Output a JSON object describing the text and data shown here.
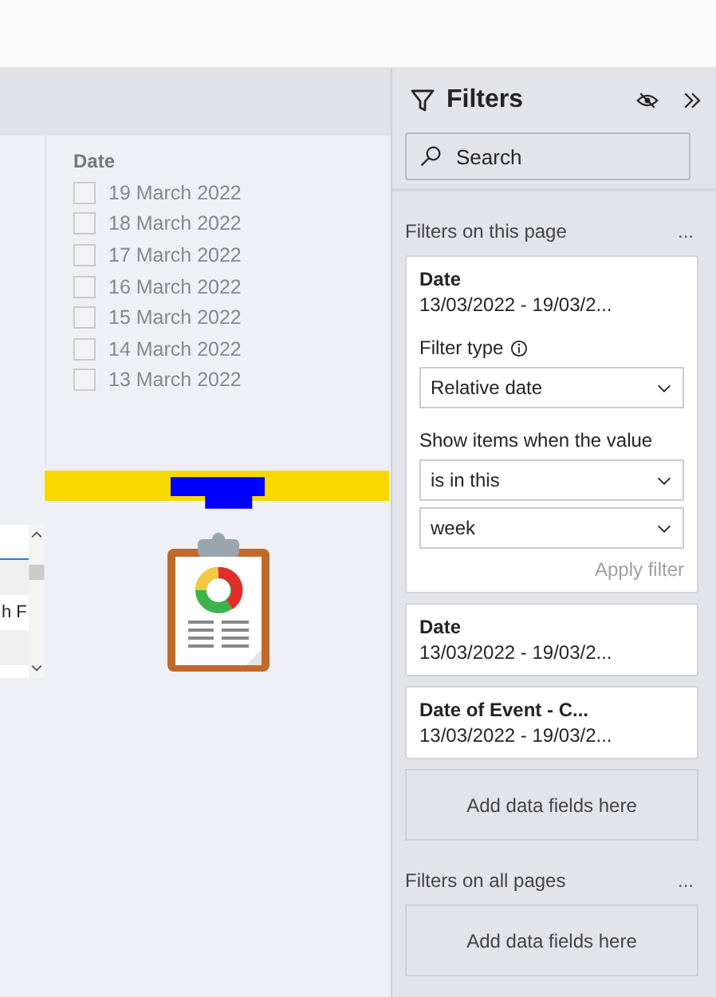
{
  "canvas": {
    "slicer": {
      "title": "Date",
      "items": [
        {
          "label": "19 March 2022",
          "checked": false
        },
        {
          "label": "18 March 2022",
          "checked": false
        },
        {
          "label": "17 March 2022",
          "checked": false
        },
        {
          "label": "16 March 2022",
          "checked": false
        },
        {
          "label": "15 March 2022",
          "checked": false
        },
        {
          "label": "14 March 2022",
          "checked": false
        },
        {
          "label": "13 March 2022",
          "checked": false
        }
      ]
    },
    "table_fragment": {
      "cell_text": "h F"
    }
  },
  "filters_pane": {
    "title": "Filters",
    "search": {
      "placeholder": "Search"
    },
    "sections": [
      {
        "title": "Filters on this page",
        "more": "...",
        "cards": [
          {
            "field": "Date",
            "summary": "13/03/2022 - 19/03/2...",
            "expanded": true,
            "filter_type_label": "Filter type",
            "filter_type": "Relative date",
            "condition_label": "Show items when the value",
            "operator": "is in this",
            "unit": "week",
            "apply": "Apply filter"
          },
          {
            "field": "Date",
            "summary": "13/03/2022 - 19/03/2...",
            "expanded": false
          },
          {
            "field": "Date of Event - C...",
            "summary": "13/03/2022 - 19/03/2...",
            "expanded": false
          }
        ],
        "drop_zone": "Add data fields here"
      },
      {
        "title": "Filters on all pages",
        "more": "...",
        "drop_zone": "Add data fields here"
      }
    ]
  }
}
